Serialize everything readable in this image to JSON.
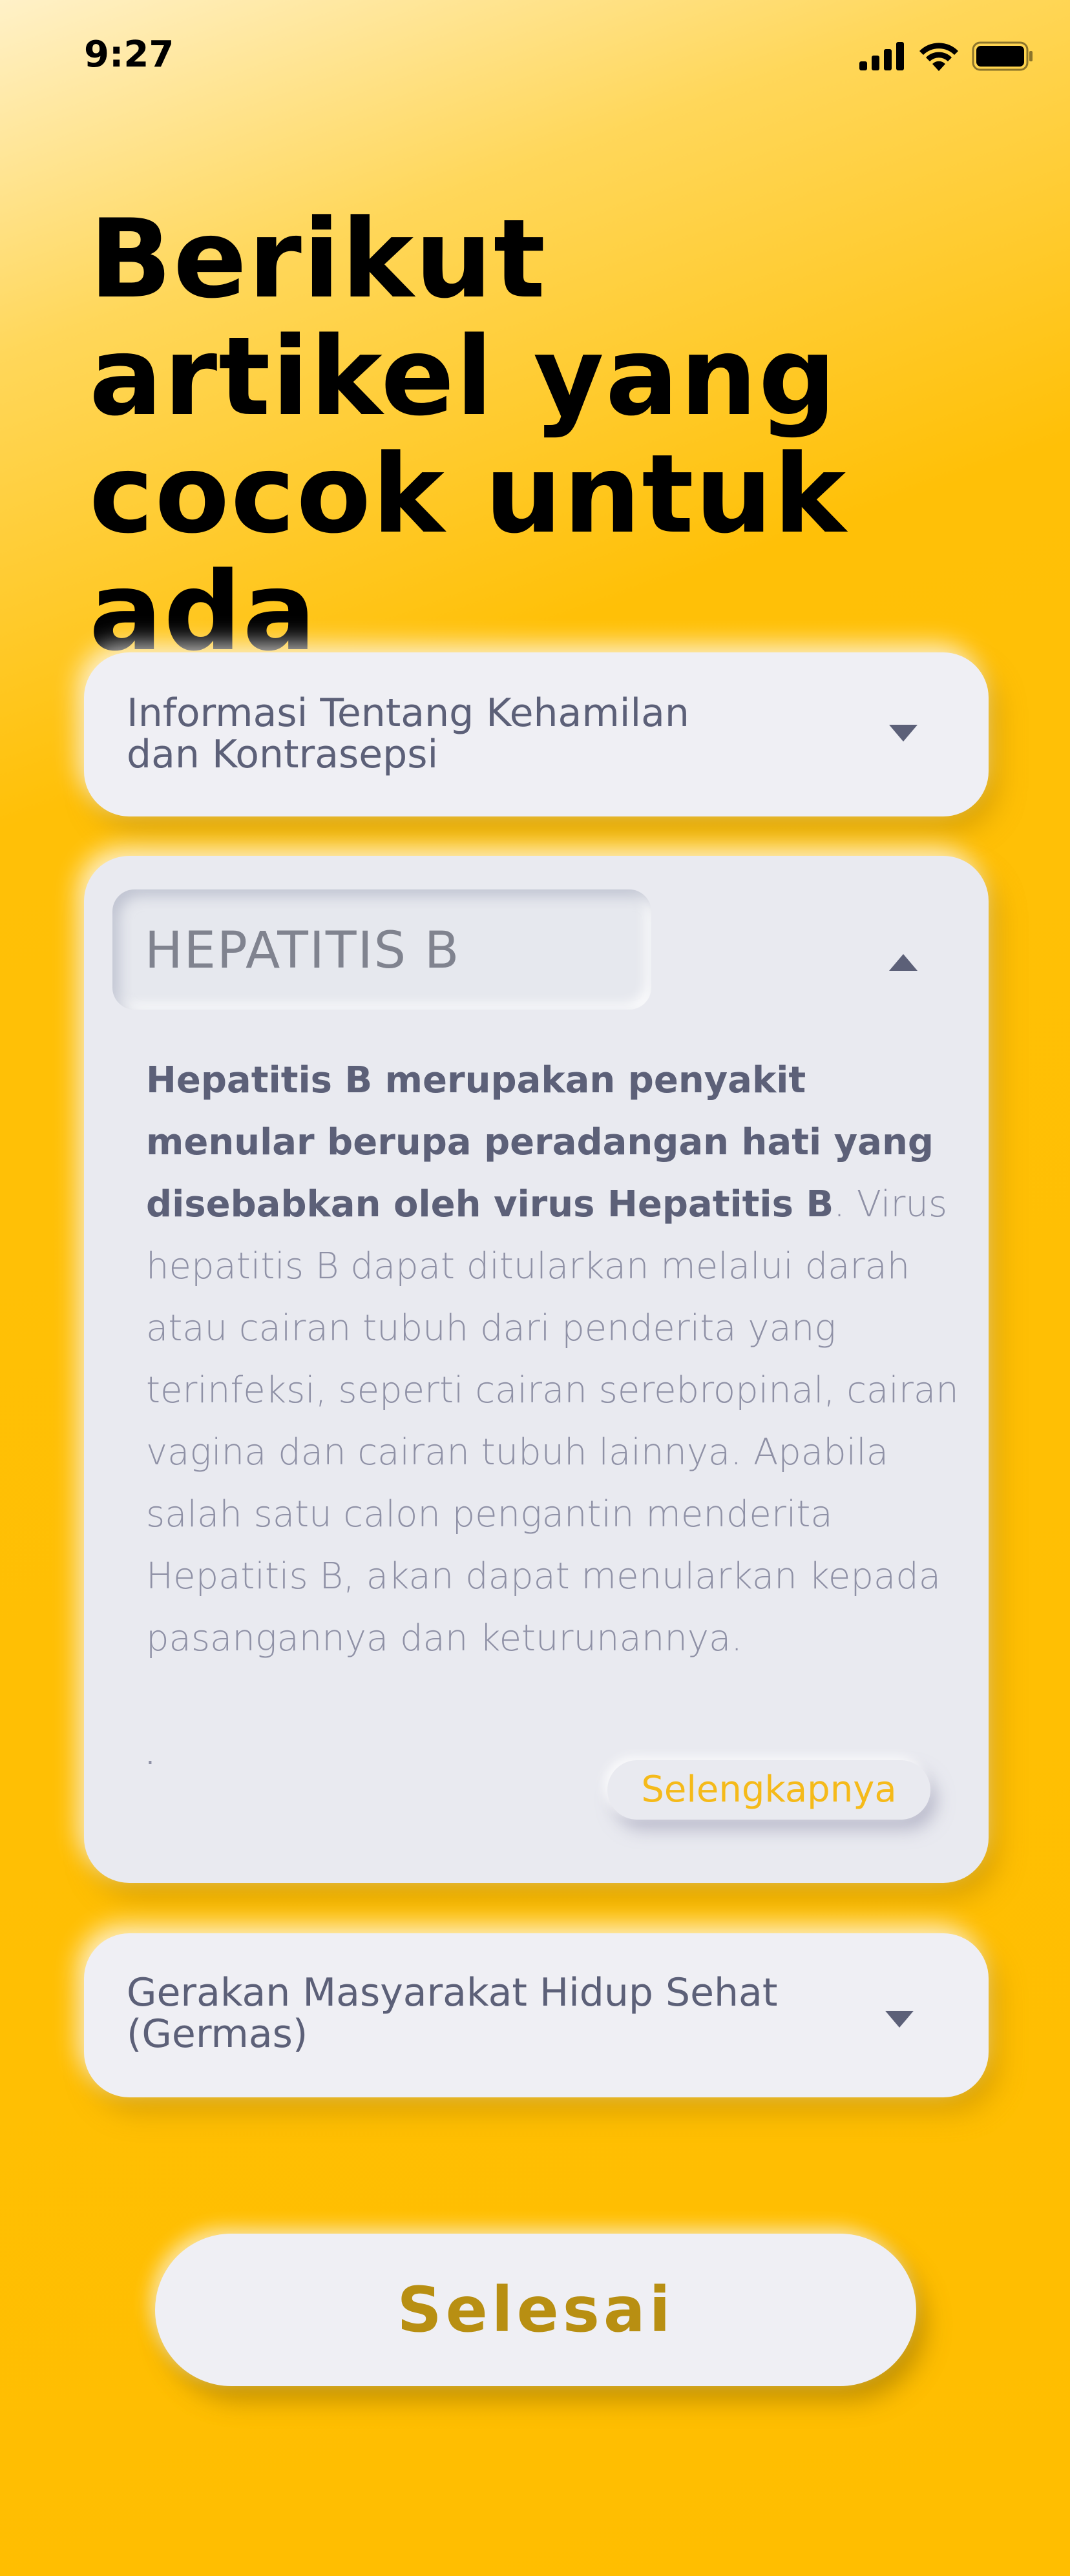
{
  "status_bar": {
    "time": "9:27",
    "icons": [
      "cellular-signal-icon",
      "wifi-icon",
      "battery-icon"
    ]
  },
  "headline": "Berikut artikel yang cocok untuk ada",
  "cards": {
    "info": {
      "title": "Informasi Tentang Kehamilan\ndan Kontrasepsi",
      "expanded": false
    },
    "hepatitis": {
      "label": "HEPATITIS B",
      "expanded": true,
      "body_bold": "Hepatitis B merupakan penyakit menular berupa peradangan hati yang disebabkan oleh virus Hepatitis B",
      "body_rest": ". Virus hepatitis B dapat ditularkan melalui darah atau cairan tubuh dari penderita yang terinfeksi, seperti cairan serebropinal, cairan vagina dan cairan tubuh lainnya. Apabila salah satu calon pengantin menderita Hepatitis B, akan dapat menularkan kepada pasangannya dan keturunannya.",
      "trailing_dot": ".",
      "more_label": "Selengkapnya"
    },
    "germas": {
      "title": "Gerakan Masyarakat Hidup Sehat\n(Germas)",
      "expanded": false
    }
  },
  "done_button": "Selesai",
  "colors": {
    "background_top": "#fff1c8",
    "background_main": "#ffbe00",
    "card": "#efeff4",
    "card_text": "#5c6078",
    "muted_text": "#8f91a6",
    "accent_link": "#f5ba1a",
    "done_text": "#b88f12"
  }
}
